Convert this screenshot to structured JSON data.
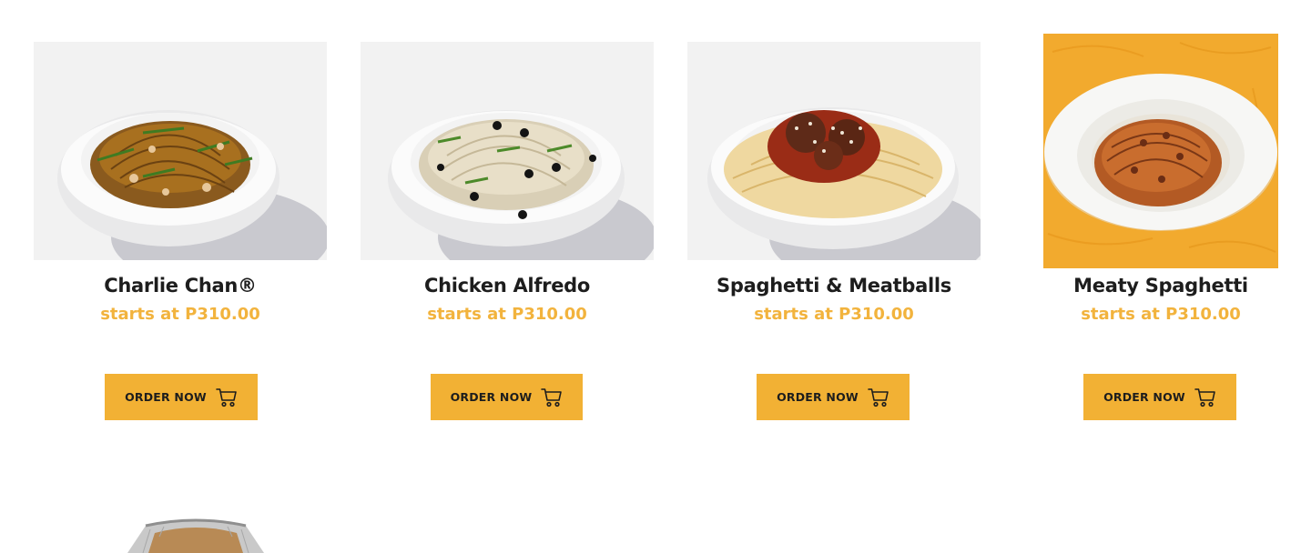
{
  "colors": {
    "accent": "#f2b134",
    "price": "#f2b33d",
    "title": "#1d1d1d",
    "background": "#ffffff"
  },
  "products": [
    {
      "name": "Charlie Chan®",
      "price": "starts at P310.00",
      "button_label": "ORDER NOW",
      "button_icon": "cart-icon",
      "image": "charlie-chan-pasta-photo"
    },
    {
      "name": "Chicken Alfredo",
      "price": "starts at P310.00",
      "button_label": "ORDER NOW",
      "button_icon": "cart-icon",
      "image": "chicken-alfredo-pasta-photo"
    },
    {
      "name": "Spaghetti & Meatballs",
      "price": "starts at P310.00",
      "button_label": "ORDER NOW",
      "button_icon": "cart-icon",
      "image": "spaghetti-meatballs-photo"
    },
    {
      "name": "Meaty Spaghetti",
      "price": "starts at P310.00",
      "button_label": "ORDER NOW",
      "button_icon": "cart-icon",
      "image": "meaty-spaghetti-photo"
    }
  ],
  "next_row_partial": {
    "image": "foil-tray-photo"
  }
}
